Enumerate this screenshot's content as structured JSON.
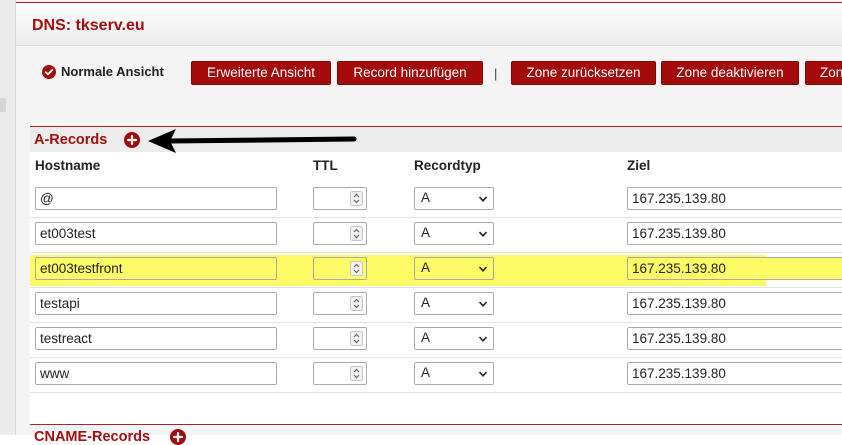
{
  "page": {
    "title": "DNS: tkserv.eu"
  },
  "toolbar": {
    "normal_view": "Normale Ansicht",
    "extended_view": "Erweiterte Ansicht",
    "add_record": "Record hinzufügen",
    "separator": "|",
    "reset_zone": "Zone zurücksetzen",
    "deactivate_zone": "Zone deaktivieren",
    "next_button_fragment": "Zon"
  },
  "colors": {
    "accent": "#a40b0b",
    "highlight": "#fdfc66"
  },
  "icons": {
    "normal_view": "check-circle-icon",
    "add_record": "plus-circle-icon",
    "annotation": "arrow-left-icon",
    "ttl_spinner": "stepper-updown-icon",
    "recordtype_select": "chevron-down-icon"
  },
  "a_records": {
    "title": "A-Records",
    "columns": {
      "hostname": "Hostname",
      "ttl": "TTL",
      "recordtype": "Recordtyp",
      "ziel": "Ziel"
    },
    "rows": [
      {
        "hostname": "@",
        "ttl": "",
        "type": "A",
        "ziel": "167.235.139.80",
        "highlighted": false
      },
      {
        "hostname": "et003test",
        "ttl": "",
        "type": "A",
        "ziel": "167.235.139.80",
        "highlighted": false
      },
      {
        "hostname": "et003testfront",
        "ttl": "",
        "type": "A",
        "ziel": "167.235.139.80",
        "highlighted": true
      },
      {
        "hostname": "testapi",
        "ttl": "",
        "type": "A",
        "ziel": "167.235.139.80",
        "highlighted": false
      },
      {
        "hostname": "testreact",
        "ttl": "",
        "type": "A",
        "ziel": "167.235.139.80",
        "highlighted": false
      },
      {
        "hostname": "www",
        "ttl": "",
        "type": "A",
        "ziel": "167.235.139.80",
        "highlighted": false
      }
    ]
  },
  "next_section": {
    "title": "CNAME-Records"
  }
}
